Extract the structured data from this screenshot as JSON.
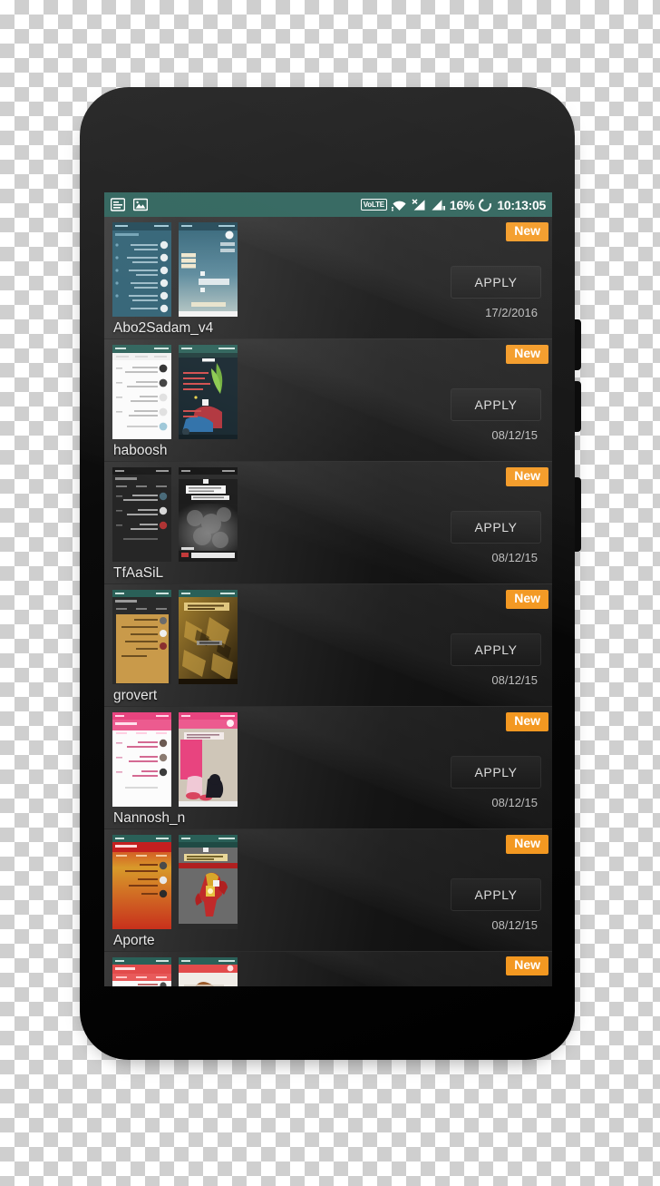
{
  "status_bar": {
    "notification_icons": [
      "list-notification-icon",
      "image-notification-icon"
    ],
    "volte_label": "VoLTE",
    "wifi_icon": "wifi-icon",
    "signal_icons": [
      "signal-no-service-icon",
      "signal-bars-icon"
    ],
    "battery_percent": "16%",
    "battery_ring_icon": "battery-ring-icon",
    "clock": "10:13:05",
    "background_color": "#2a6058"
  },
  "list": {
    "badge_new_label": "New",
    "badge_new_color": "#f39821",
    "apply_label": "APPLY",
    "items": [
      {
        "name": "Abo2Sadam_v4",
        "date": "17/2/2016",
        "badge": "New",
        "apply": "APPLY",
        "accent": "#2d5f72",
        "accent2": "#37708a"
      },
      {
        "name": "haboosh",
        "date": "08/12/15",
        "badge": "New",
        "apply": "APPLY",
        "accent": "#f7f7f7",
        "accent2": "#4a8c3a"
      },
      {
        "name": "TfAaSiL",
        "date": "08/12/15",
        "badge": "New",
        "apply": "APPLY",
        "accent": "#2b2b2b",
        "accent2": "#4b4b4b"
      },
      {
        "name": "grovert",
        "date": "08/12/15",
        "badge": "New",
        "apply": "APPLY",
        "accent": "#c99a4a",
        "accent2": "#8a6a2a"
      },
      {
        "name": "Nannosh_n",
        "date": "08/12/15",
        "badge": "New",
        "apply": "APPLY",
        "accent": "#f2f2f2",
        "accent2": "#e8447f"
      },
      {
        "name": "Aporte",
        "date": "08/12/15",
        "badge": "New",
        "apply": "APPLY",
        "accent": "#cf2020",
        "accent2": "#a33030"
      },
      {
        "name": "",
        "date": "",
        "badge": "New",
        "apply": "",
        "accent": "#e85a5a",
        "accent2": "#d86a5a"
      }
    ]
  }
}
